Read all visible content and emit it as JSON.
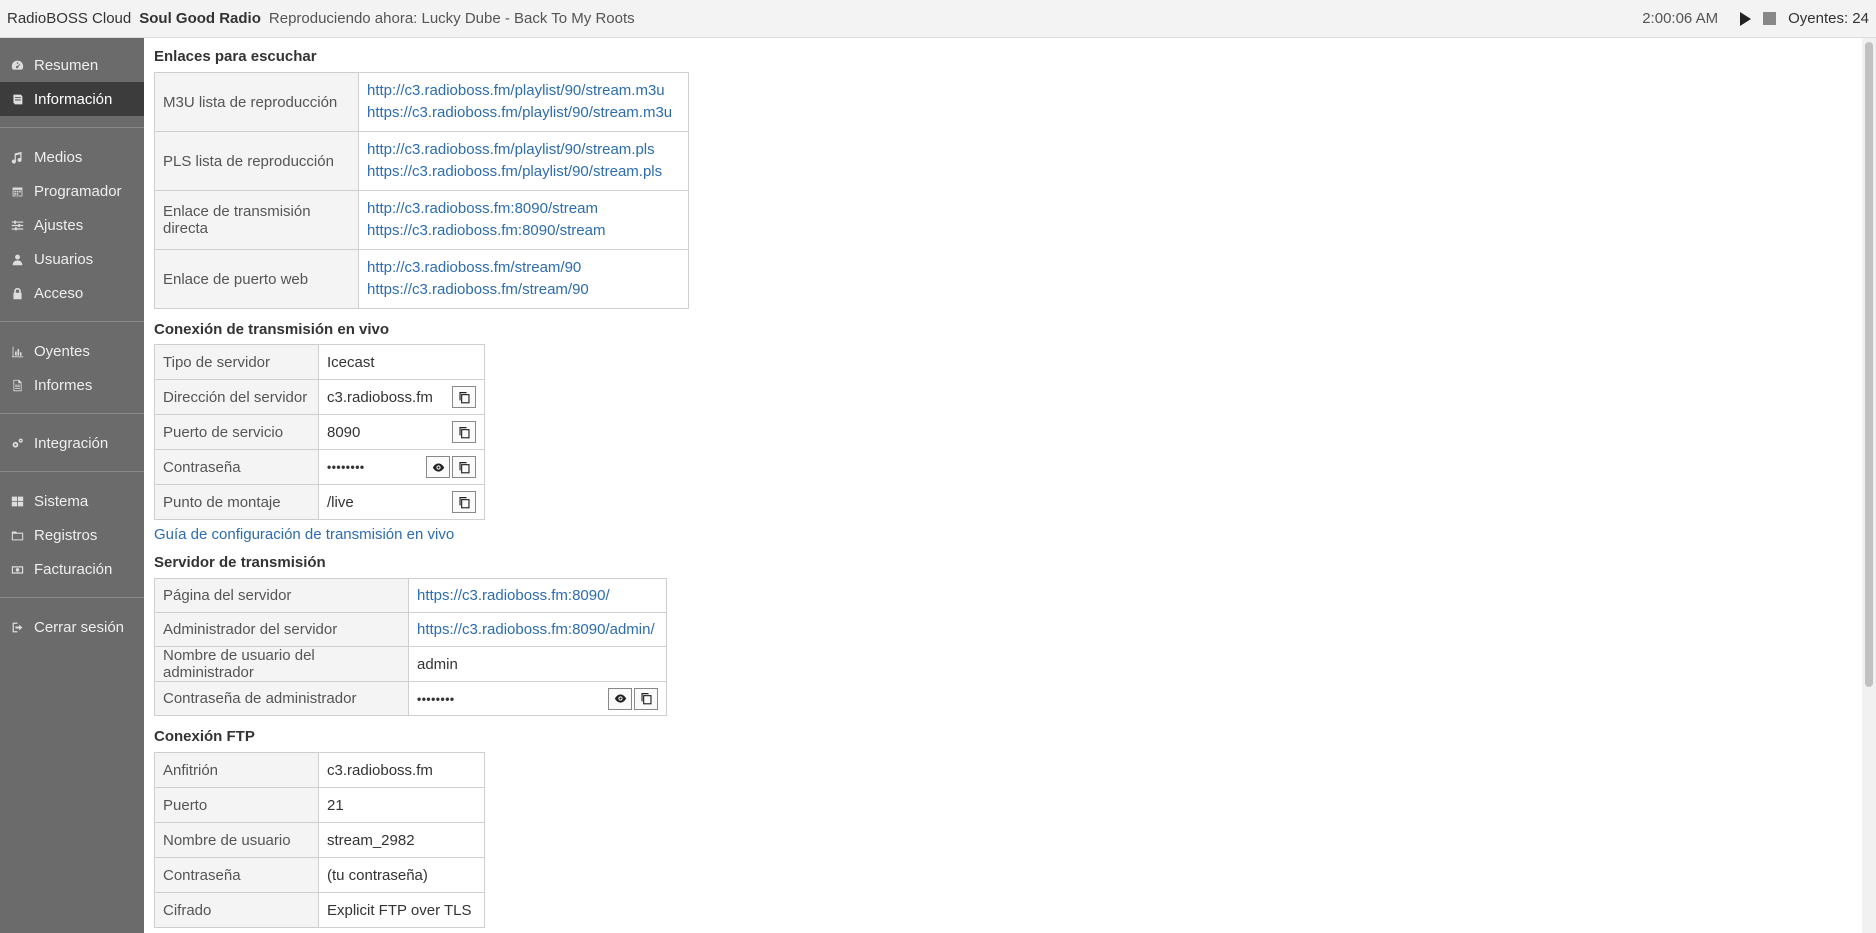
{
  "topbar": {
    "app_name": "RadioBOSS Cloud",
    "station": "Soul Good Radio",
    "now_playing": "Reproduciendo ahora: Lucky Dube - Back To My Roots",
    "time": "2:00:06 AM",
    "listeners": "Oyentes: 24"
  },
  "sidebar": {
    "items": [
      {
        "label": "Resumen",
        "icon": "dashboard-icon"
      },
      {
        "label": "Información",
        "icon": "book-icon",
        "active": true
      },
      {
        "label": "Medios",
        "icon": "music-icon"
      },
      {
        "label": "Programador",
        "icon": "calendar-icon"
      },
      {
        "label": "Ajustes",
        "icon": "sliders-icon"
      },
      {
        "label": "Usuarios",
        "icon": "user-icon"
      },
      {
        "label": "Acceso",
        "icon": "lock-icon"
      },
      {
        "label": "Oyentes",
        "icon": "bar-chart-icon"
      },
      {
        "label": "Informes",
        "icon": "file-icon"
      },
      {
        "label": "Integración",
        "icon": "gears-icon"
      },
      {
        "label": "Sistema",
        "icon": "grid-icon"
      },
      {
        "label": "Registros",
        "icon": "folder-icon"
      },
      {
        "label": "Facturación",
        "icon": "money-icon"
      },
      {
        "label": "Cerrar sesión",
        "icon": "sign-out-icon"
      }
    ]
  },
  "listen_links": {
    "heading": "Enlaces para escuchar",
    "rows": [
      {
        "label": "M3U lista de reproducción",
        "links": [
          "http://c3.radioboss.fm/playlist/90/stream.m3u",
          "https://c3.radioboss.fm/playlist/90/stream.m3u"
        ]
      },
      {
        "label": "PLS lista de reproducción",
        "links": [
          "http://c3.radioboss.fm/playlist/90/stream.pls",
          "https://c3.radioboss.fm/playlist/90/stream.pls"
        ]
      },
      {
        "label": "Enlace de transmisión directa",
        "links": [
          "http://c3.radioboss.fm:8090/stream",
          "https://c3.radioboss.fm:8090/stream"
        ]
      },
      {
        "label": "Enlace de puerto web",
        "links": [
          "http://c3.radioboss.fm/stream/90",
          "https://c3.radioboss.fm/stream/90"
        ]
      }
    ]
  },
  "live": {
    "heading": "Conexión de transmisión en vivo",
    "rows": [
      {
        "label": "Tipo de servidor",
        "value": "Icecast"
      },
      {
        "label": "Dirección del servidor",
        "value": "c3.radioboss.fm"
      },
      {
        "label": "Puerto de servicio",
        "value": "8090"
      },
      {
        "label": "Contraseña",
        "value": "••••••••"
      },
      {
        "label": "Punto de montaje",
        "value": "/live"
      }
    ],
    "guide_link": "Guía de configuración de transmisión en vivo"
  },
  "server": {
    "heading": "Servidor de transmisión",
    "rows": [
      {
        "label": "Página del servidor",
        "value": "https://c3.radioboss.fm:8090/"
      },
      {
        "label": "Administrador del servidor",
        "value": "https://c3.radioboss.fm:8090/admin/"
      },
      {
        "label": "Nombre de usuario del administrador",
        "value": "admin"
      },
      {
        "label": "Contraseña de administrador",
        "value": "••••••••"
      }
    ]
  },
  "ftp": {
    "heading": "Conexión FTP",
    "rows": [
      {
        "label": "Anfitrión",
        "value": "c3.radioboss.fm"
      },
      {
        "label": "Puerto",
        "value": "21"
      },
      {
        "label": "Nombre de usuario",
        "value": "stream_2982"
      },
      {
        "label": "Contraseña",
        "value": "(tu contraseña)"
      },
      {
        "label": "Cifrado",
        "value": "Explicit FTP over TLS"
      }
    ]
  }
}
